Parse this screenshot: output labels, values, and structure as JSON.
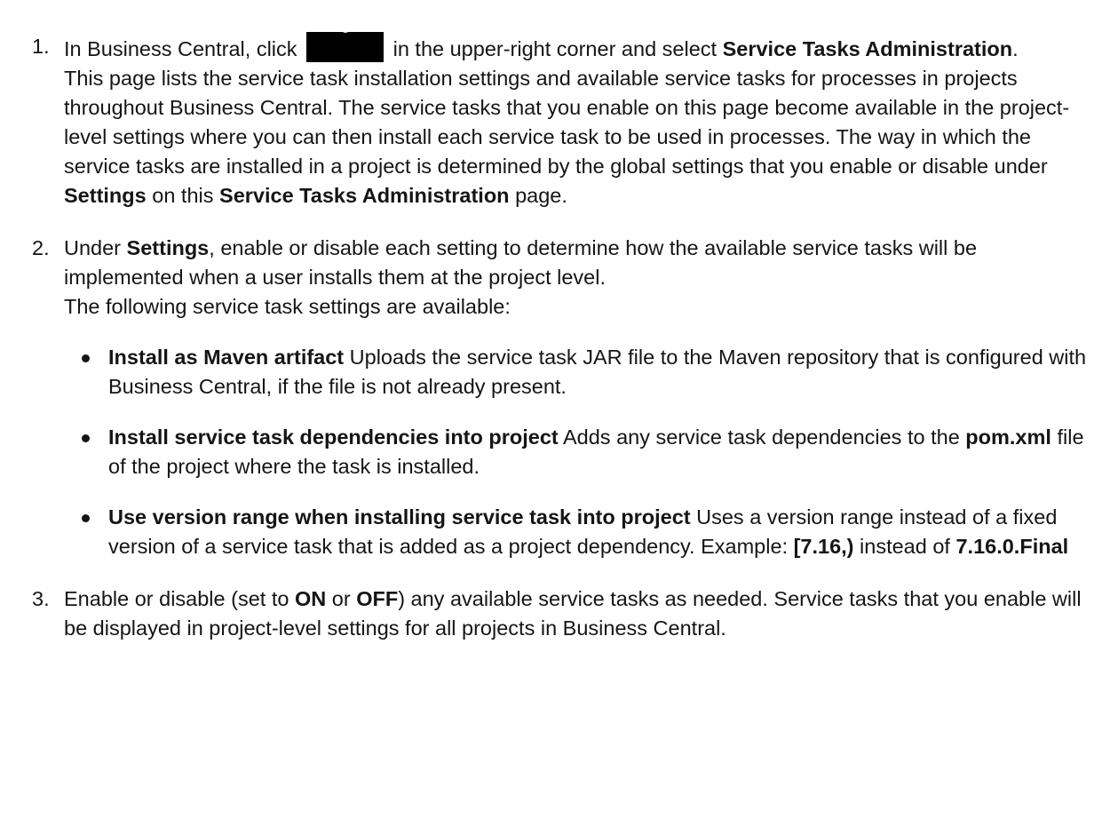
{
  "steps": [
    {
      "number": "1.",
      "line1_a": "In Business Central, click",
      "icon": "gear-icon",
      "line1_b": "in the upper-right corner and select",
      "line1_bold": "Service Tasks Administration",
      "line1_end": ".",
      "desc_a": "This page lists the service task installation settings and available service tasks for processes in projects throughout Business Central. The service tasks that you enable on this page become available in the project-level settings where you can then install each service task to be used in processes. The way in which the service tasks are installed in a project is determined by the global settings that you enable or disable under",
      "desc_bold1": "Settings",
      "desc_b": "on this",
      "desc_bold2": "Service Tasks Administration",
      "desc_c": "page."
    },
    {
      "number": "2.",
      "a": "Under",
      "bold": "Settings",
      "b": ", enable or disable each setting to determine how the available service tasks will be implemented when a user installs them at the project level.",
      "sub": "The following service task settings are available:",
      "items": [
        {
          "title": "Install as Maven artifact",
          "text": "Uploads the service task JAR file to the Maven repository that is configured with Business Central, if the file is not already present."
        },
        {
          "title": "Install service task dependencies into project",
          "text_a": "Adds any service task dependencies to the",
          "code": "pom.xml",
          "text_b": "file of the project where the task is installed."
        },
        {
          "title": "Use version range when installing service task into project",
          "text_a": "Uses a version range instead of a fixed version of a service task that is added as a project dependency. Example:",
          "code1": "[7.16,)",
          "text_b": "instead of",
          "code2": "7.16.0.Final"
        }
      ]
    },
    {
      "number": "3.",
      "a": "Enable or disable (set to",
      "on": "ON",
      "or": "or",
      "off": "OFF",
      "b": ") any available service tasks as needed. Service tasks that you enable will be displayed in project-level settings for all projects in Business Central."
    }
  ]
}
